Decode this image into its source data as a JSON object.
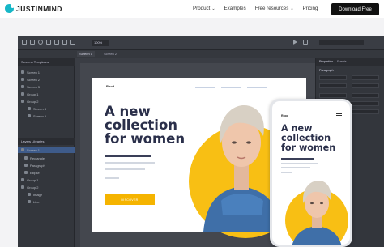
{
  "nav": {
    "logo_text": "JUSTINMIND",
    "links": [
      {
        "label": "Product",
        "has_chevron": true
      },
      {
        "label": "Examples",
        "has_chevron": false
      },
      {
        "label": "Free resources",
        "has_chevron": true
      },
      {
        "label": "Pricing",
        "has_chevron": false
      }
    ],
    "cta_label": "Download Free"
  },
  "app": {
    "tabs": [
      "Screen 1",
      "Screen 2"
    ],
    "left_panel": {
      "tabs": [
        "Screens",
        "Templates"
      ],
      "screens": [
        "Screen 1",
        "Screen 2",
        "Screen 3",
        "Group 1",
        "Group 2",
        "Screen 4",
        "Screen 5"
      ],
      "layers_tabs": [
        "Layers",
        "Libraries"
      ],
      "layers": [
        "Screen 1",
        "Rectangle",
        "Paragraph",
        "Ellipse",
        "Group 1",
        "Group 2",
        "Image",
        "Line"
      ]
    },
    "right_panel": {
      "tabs": [
        "Properties",
        "Events"
      ],
      "section": "Paragraph"
    },
    "zoom": "100%"
  },
  "web_mockup": {
    "logo": "Rnod",
    "title_lines": [
      "A new",
      "collection",
      "for women"
    ],
    "button_label": "DISCOVER"
  },
  "phone_mockup": {
    "logo": "Rnod",
    "title_lines": [
      "A new",
      "collection",
      "for women"
    ]
  },
  "colors": {
    "accent": "#f8bf14",
    "brand": "#17b7c7",
    "title": "#2a2f4a"
  }
}
